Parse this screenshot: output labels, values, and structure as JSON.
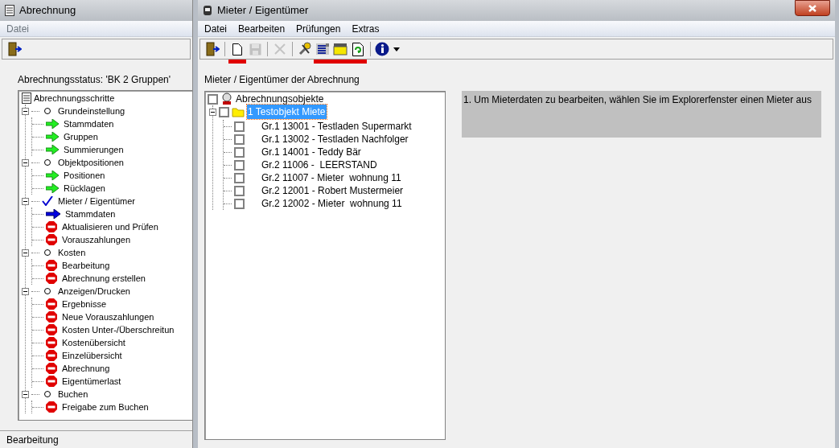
{
  "back_window": {
    "title": "Abrechnung",
    "menu": [
      "Datei"
    ],
    "status_label": "Abrechnungsstatus: 'BK 2 Gruppen'",
    "tree": {
      "label": "Abrechnungsschritte",
      "children": [
        {
          "label": "Grundeinstellung",
          "done": false,
          "expanded": true,
          "children": [
            {
              "label": "Stammdaten",
              "kind": "done"
            },
            {
              "label": "Gruppen",
              "kind": "done"
            },
            {
              "label": "Summierungen",
              "kind": "done"
            }
          ]
        },
        {
          "label": "Objektpositionen",
          "done": false,
          "expanded": true,
          "children": [
            {
              "label": "Positionen",
              "kind": "done"
            },
            {
              "label": "Rücklagen",
              "kind": "done"
            }
          ]
        },
        {
          "label": "Mieter / Eigentümer",
          "done": true,
          "expanded": true,
          "children": [
            {
              "label": "Stammdaten",
              "kind": "current"
            },
            {
              "label": "Aktualisieren und Prüfen",
              "kind": "blocked"
            },
            {
              "label": "Vorauszahlungen",
              "kind": "blocked"
            }
          ]
        },
        {
          "label": "Kosten",
          "done": false,
          "expanded": true,
          "children": [
            {
              "label": "Bearbeitung",
              "kind": "blocked"
            },
            {
              "label": "Abrechnung erstellen",
              "kind": "blocked"
            }
          ]
        },
        {
          "label": "Anzeigen/Drucken",
          "done": false,
          "expanded": true,
          "children": [
            {
              "label": "Ergebnisse",
              "kind": "blocked"
            },
            {
              "label": "Neue Vorauszahlungen",
              "kind": "blocked"
            },
            {
              "label": "Kosten Unter-/Überschreitun",
              "kind": "blocked"
            },
            {
              "label": "Kostenübersicht",
              "kind": "blocked"
            },
            {
              "label": "Einzelübersicht",
              "kind": "blocked"
            },
            {
              "label": "Abrechnung",
              "kind": "blocked"
            },
            {
              "label": "Eigentümerlast",
              "kind": "blocked"
            }
          ]
        },
        {
          "label": "Buchen",
          "done": false,
          "expanded": true,
          "children": [
            {
              "label": "Freigabe zum Buchen",
              "kind": "blocked"
            }
          ]
        }
      ]
    },
    "status_bar": "Bearbeitung"
  },
  "front_window": {
    "title": "Mieter / Eigentümer",
    "menu": [
      "Datei",
      "Bearbeiten",
      "Prüfungen",
      "Extras"
    ],
    "toolbar": [
      [
        {
          "kind": "exit",
          "disabled": false,
          "marked": false
        }
      ],
      [
        {
          "kind": "new",
          "disabled": false,
          "marked": true
        },
        {
          "kind": "save",
          "disabled": true,
          "marked": false
        }
      ],
      [
        {
          "kind": "delete",
          "disabled": true,
          "marked": false
        }
      ],
      [
        {
          "kind": "tools",
          "disabled": false,
          "marked": false
        },
        {
          "kind": "list",
          "disabled": false,
          "marked": true
        },
        {
          "kind": "folder",
          "disabled": false,
          "marked": true
        },
        {
          "kind": "refresh",
          "disabled": false,
          "marked": true
        }
      ],
      [
        {
          "kind": "info",
          "disabled": false,
          "marked": false
        }
      ]
    ],
    "section_label": "Mieter / Eigentümer der Abrechnung",
    "tree": {
      "label": "Abrechnungsobjekte",
      "checked": false,
      "children": [
        {
          "label": "1 Testobjekt Miete",
          "checked": false,
          "selected": true,
          "expanded": true,
          "children": [
            {
              "label": "Gr.1 13001 - Testladen Supermarkt",
              "checked": false
            },
            {
              "label": "Gr.1 13002 - Testladen Nachfolger",
              "checked": false
            },
            {
              "label": "Gr.1 14001 - Teddy Bär",
              "checked": false
            },
            {
              "label": "Gr.2 11006 -  LEERSTAND",
              "checked": false
            },
            {
              "label": "Gr.2 11007 - Mieter  wohnung 11",
              "checked": false
            },
            {
              "label": "Gr.2 12001 - Robert Mustermeier",
              "checked": false
            },
            {
              "label": "Gr.2 12002 - Mieter  wohnung 11",
              "checked": false
            }
          ]
        }
      ]
    },
    "hint": "1. Um Mieterdaten zu bearbeiten, wählen Sie im Explorerfenster einen Mieter aus"
  }
}
